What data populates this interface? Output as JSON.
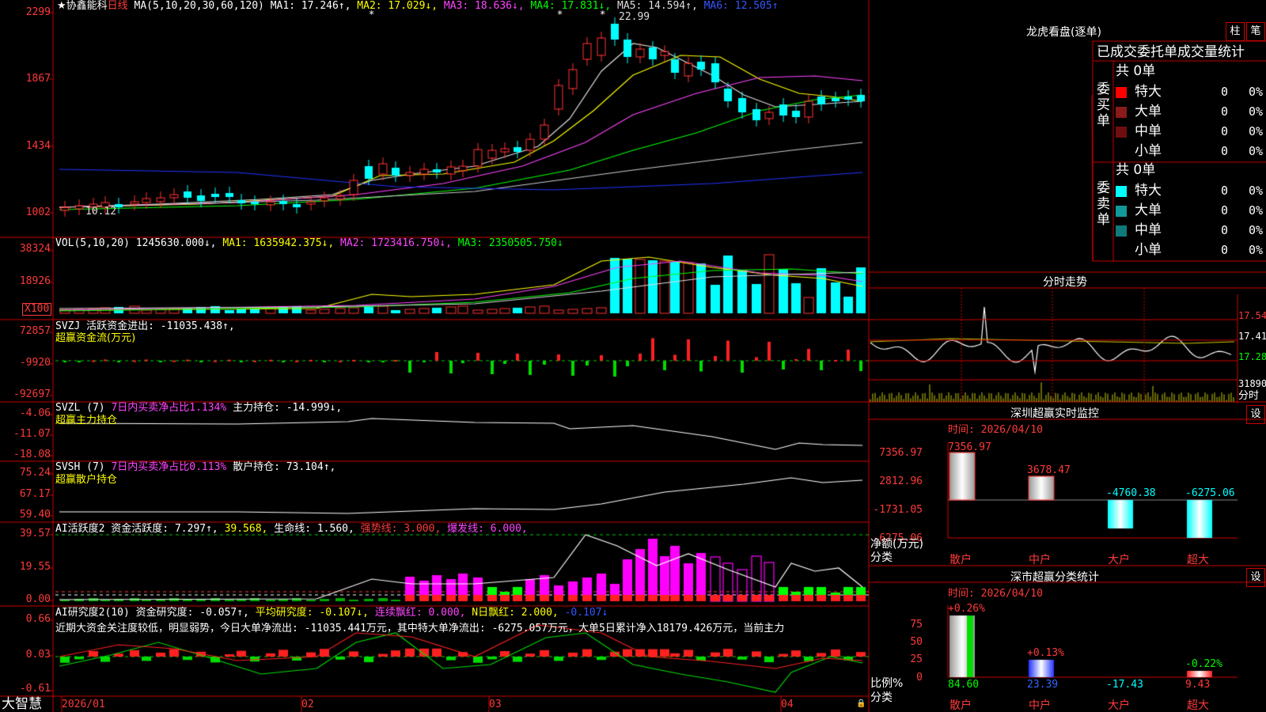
{
  "stock": {
    "star": "★",
    "name": "协鑫能科",
    "period": "日线"
  },
  "ma": {
    "title": "MA(5,10,20,30,60,120)",
    "ma1": "MA1: 17.246↑,",
    "ma2": "MA2: 17.029↓,",
    "ma3": "MA3: 18.636↓,",
    "ma4": "MA4: 17.831↓,",
    "ma5": "MA5: 14.594↑,",
    "ma6": "MA6: 12.505↑"
  },
  "price_axis": [
    "2299",
    "1867",
    "1434",
    "1002"
  ],
  "price_marks": {
    "high": "22.99",
    "low": "10.12"
  },
  "vol": {
    "title": "VOL(5,10,20)",
    "value": "1245630.000↓,",
    "ma1": "MA1: 1635942.375↓,",
    "ma2": "MA2: 1723416.750↓,",
    "ma3": "MA3: 2350505.750↓",
    "axis": [
      "38324",
      "18926"
    ],
    "unit": "X100"
  },
  "svzj": {
    "title": "SVZJ  活跃资金进出: -11035.438↑,",
    "sub": "超赢资金流(万元)",
    "axis": [
      "72857",
      "-9920",
      "-92697"
    ]
  },
  "svzl": {
    "title": "SVZL (7)",
    "ratio": "7日内买卖净占比1.134%",
    "pos": "主力持仓: -14.999↓,",
    "sub": "超赢主力持仓",
    "axis": [
      "-4.06",
      "-11.07",
      "-18.08"
    ]
  },
  "svsh": {
    "title": "SVSH (7)",
    "ratio": "7日内买卖净占比0.113%",
    "pos": "散户持仓: 73.104↑,",
    "sub": "超赢散户持仓",
    "axis": [
      "75.24",
      "67.17",
      "59.40"
    ]
  },
  "ai1": {
    "title": "AI活跃度2 资金活跃度: 7.297↑,",
    "v2": "39.568,",
    "life": "生命线: 1.560,",
    "strong": "强势线: 3.000,",
    "burst": "爆发线: 6.000,",
    "axis": [
      "39.57",
      "19.55",
      "0.00"
    ]
  },
  "ai2": {
    "title": "AI研究度2(10) 资金研究度: -0.057↑,",
    "avg": "平均研究度: -0.107↓,",
    "lian": "连续飘红: 0.000,",
    "nday": "N日飘红: 2.000,",
    "last": "-0.107↓",
    "comment": "近期大资金关注度较低，明显弱势，今日大单净流出: -11035.441万元，其中特大单净流出: -6275.057万元，大单5日累计净入18179.426万元，当前主力",
    "axis": [
      "0.66",
      "0.03",
      "-0.61"
    ]
  },
  "date_axis": [
    "2026/01",
    "02",
    "03",
    "04"
  ],
  "logo": "大智慧",
  "dragon": {
    "title": "龙虎看盘(逐单)",
    "btn1": "柱",
    "btn2": "笔",
    "header": "已成交委托单成交量统计",
    "buy": {
      "label": "委买单",
      "total": "共 0单",
      "rows": [
        {
          "name": "特大",
          "count": "0",
          "pct": "0%"
        },
        {
          "name": "大单",
          "count": "0",
          "pct": "0%"
        },
        {
          "name": "中单",
          "count": "0",
          "pct": "0%"
        },
        {
          "name": "小单",
          "count": "0",
          "pct": "0%"
        }
      ],
      "colors": [
        "#ff0000",
        "#8b1a1a",
        "#6e0e0e"
      ]
    },
    "sell": {
      "label": "委卖单",
      "total": "共 0单",
      "rows": [
        {
          "name": "特大",
          "count": "0",
          "pct": "0%"
        },
        {
          "name": "大单",
          "count": "0",
          "pct": "0%"
        },
        {
          "name": "中单",
          "count": "0",
          "pct": "0%"
        },
        {
          "name": "小单",
          "count": "0",
          "pct": "0%"
        }
      ],
      "colors": [
        "#00ffff",
        "#119999",
        "#0e7a7a"
      ]
    }
  },
  "intraday": {
    "title": "分时走势",
    "axis": [
      "17.54",
      "17.41",
      "17.28"
    ],
    "vol_top": "31890",
    "label": "分时"
  },
  "sz_monitor": {
    "title": "深圳超赢实时监控",
    "settings": "设",
    "time": "时间: 2026/04/10",
    "axis": [
      "7356.97",
      "2812.96",
      "-1731.05",
      "-6275.06"
    ],
    "ylabel": "净额(万元)",
    "xlabel": "分类",
    "categories": [
      "散户",
      "中户",
      "大户",
      "超大"
    ],
    "values": [
      "7356.97",
      "3678.47",
      "-4760.38",
      "-6275.06"
    ]
  },
  "sz_class": {
    "title": "深市超赢分类统计",
    "settings": "设",
    "time": "时间: 2026/04/10",
    "axis": [
      "75",
      "50",
      "25",
      "0"
    ],
    "ylabel": "比例%",
    "xlabel": "分类",
    "categories": [
      "散户",
      "中户",
      "大户",
      "超大"
    ],
    "pcts": [
      "+0.26%",
      "+0.13%",
      "",
      "-0.22%"
    ],
    "values": [
      "84.60",
      "23.39",
      "-17.43",
      "9.43"
    ]
  }
}
